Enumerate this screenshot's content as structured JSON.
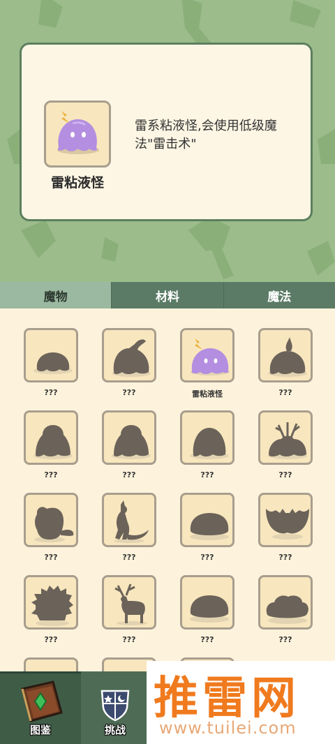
{
  "detail": {
    "name": "雷粘液怪",
    "description": "雷系粘液怪,会使用低级魔法\"雷击术\""
  },
  "tabs": [
    {
      "label": "魔物",
      "active": true
    },
    {
      "label": "材料",
      "active": false
    },
    {
      "label": "魔法",
      "active": false
    }
  ],
  "grid": {
    "items": [
      {
        "label": "???",
        "icon": "slime-silhouette"
      },
      {
        "label": "???",
        "icon": "leaf-slime-silhouette"
      },
      {
        "label": "雷粘液怪",
        "icon": "thunder-slime"
      },
      {
        "label": "???",
        "icon": "flame-slime-silhouette"
      },
      {
        "label": "???",
        "icon": "bell-slime-silhouette"
      },
      {
        "label": "???",
        "icon": "bell-slime-silhouette"
      },
      {
        "label": "???",
        "icon": "dome-slime-silhouette"
      },
      {
        "label": "???",
        "icon": "antler-slime-silhouette"
      },
      {
        "label": "???",
        "icon": "creature-silhouette"
      },
      {
        "label": "???",
        "icon": "kangaroo-silhouette"
      },
      {
        "label": "???",
        "icon": "blob-silhouette"
      },
      {
        "label": "???",
        "icon": "bat-silhouette"
      },
      {
        "label": "???",
        "icon": "hedgehog-silhouette"
      },
      {
        "label": "???",
        "icon": "deer-silhouette"
      },
      {
        "label": "???",
        "icon": "blob-silhouette"
      },
      {
        "label": "???",
        "icon": "cloud-blob-silhouette"
      }
    ]
  },
  "nav": {
    "atlas_label": "图鉴",
    "challenge_label": "挑战"
  },
  "watermark": {
    "main": "推雷网",
    "sub": "www.tuilei.com"
  },
  "colors": {
    "top_background": "#9cbd8b",
    "silhouette": "#6b6359",
    "tile_bg": "#f8e6be",
    "slime_purple": "#b48ee0",
    "watermark_orange": "#f07a1e"
  }
}
